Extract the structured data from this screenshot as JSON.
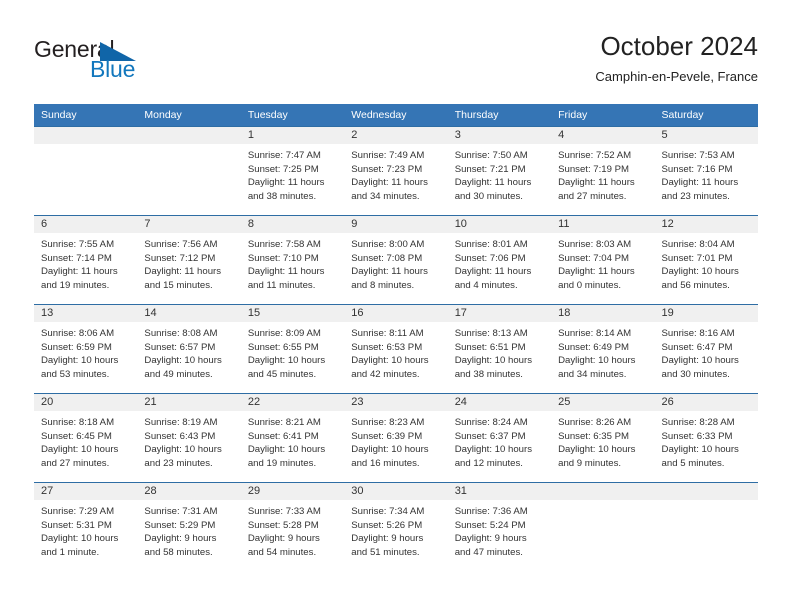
{
  "brand": {
    "name_part1": "General",
    "name_part2": "Blue",
    "logo_icon": "blue-triangle-flag-icon",
    "colors": {
      "text_dark": "#231f20",
      "blue": "#1277bd"
    }
  },
  "header": {
    "title": "October 2024",
    "subtitle": "Camphin-en-Pevele, France"
  },
  "theme": {
    "header_blue": "#3575b5",
    "row_divider_blue": "#2e6da4",
    "daynum_band": "#f0f0f0",
    "body_text": "#333333"
  },
  "weekday_headers": [
    "Sunday",
    "Monday",
    "Tuesday",
    "Wednesday",
    "Thursday",
    "Friday",
    "Saturday"
  ],
  "weeks": [
    [
      {
        "day": "",
        "blank": true,
        "sunrise": "",
        "sunset": "",
        "daylight_line1": "",
        "daylight_line2": ""
      },
      {
        "day": "",
        "blank": true,
        "sunrise": "",
        "sunset": "",
        "daylight_line1": "",
        "daylight_line2": ""
      },
      {
        "day": "1",
        "blank": false,
        "sunrise": "Sunrise: 7:47 AM",
        "sunset": "Sunset: 7:25 PM",
        "daylight_line1": "Daylight: 11 hours",
        "daylight_line2": "and 38 minutes."
      },
      {
        "day": "2",
        "blank": false,
        "sunrise": "Sunrise: 7:49 AM",
        "sunset": "Sunset: 7:23 PM",
        "daylight_line1": "Daylight: 11 hours",
        "daylight_line2": "and 34 minutes."
      },
      {
        "day": "3",
        "blank": false,
        "sunrise": "Sunrise: 7:50 AM",
        "sunset": "Sunset: 7:21 PM",
        "daylight_line1": "Daylight: 11 hours",
        "daylight_line2": "and 30 minutes."
      },
      {
        "day": "4",
        "blank": false,
        "sunrise": "Sunrise: 7:52 AM",
        "sunset": "Sunset: 7:19 PM",
        "daylight_line1": "Daylight: 11 hours",
        "daylight_line2": "and 27 minutes."
      },
      {
        "day": "5",
        "blank": false,
        "sunrise": "Sunrise: 7:53 AM",
        "sunset": "Sunset: 7:16 PM",
        "daylight_line1": "Daylight: 11 hours",
        "daylight_line2": "and 23 minutes."
      }
    ],
    [
      {
        "day": "6",
        "blank": false,
        "sunrise": "Sunrise: 7:55 AM",
        "sunset": "Sunset: 7:14 PM",
        "daylight_line1": "Daylight: 11 hours",
        "daylight_line2": "and 19 minutes."
      },
      {
        "day": "7",
        "blank": false,
        "sunrise": "Sunrise: 7:56 AM",
        "sunset": "Sunset: 7:12 PM",
        "daylight_line1": "Daylight: 11 hours",
        "daylight_line2": "and 15 minutes."
      },
      {
        "day": "8",
        "blank": false,
        "sunrise": "Sunrise: 7:58 AM",
        "sunset": "Sunset: 7:10 PM",
        "daylight_line1": "Daylight: 11 hours",
        "daylight_line2": "and 11 minutes."
      },
      {
        "day": "9",
        "blank": false,
        "sunrise": "Sunrise: 8:00 AM",
        "sunset": "Sunset: 7:08 PM",
        "daylight_line1": "Daylight: 11 hours",
        "daylight_line2": "and 8 minutes."
      },
      {
        "day": "10",
        "blank": false,
        "sunrise": "Sunrise: 8:01 AM",
        "sunset": "Sunset: 7:06 PM",
        "daylight_line1": "Daylight: 11 hours",
        "daylight_line2": "and 4 minutes."
      },
      {
        "day": "11",
        "blank": false,
        "sunrise": "Sunrise: 8:03 AM",
        "sunset": "Sunset: 7:04 PM",
        "daylight_line1": "Daylight: 11 hours",
        "daylight_line2": "and 0 minutes."
      },
      {
        "day": "12",
        "blank": false,
        "sunrise": "Sunrise: 8:04 AM",
        "sunset": "Sunset: 7:01 PM",
        "daylight_line1": "Daylight: 10 hours",
        "daylight_line2": "and 56 minutes."
      }
    ],
    [
      {
        "day": "13",
        "blank": false,
        "sunrise": "Sunrise: 8:06 AM",
        "sunset": "Sunset: 6:59 PM",
        "daylight_line1": "Daylight: 10 hours",
        "daylight_line2": "and 53 minutes."
      },
      {
        "day": "14",
        "blank": false,
        "sunrise": "Sunrise: 8:08 AM",
        "sunset": "Sunset: 6:57 PM",
        "daylight_line1": "Daylight: 10 hours",
        "daylight_line2": "and 49 minutes."
      },
      {
        "day": "15",
        "blank": false,
        "sunrise": "Sunrise: 8:09 AM",
        "sunset": "Sunset: 6:55 PM",
        "daylight_line1": "Daylight: 10 hours",
        "daylight_line2": "and 45 minutes."
      },
      {
        "day": "16",
        "blank": false,
        "sunrise": "Sunrise: 8:11 AM",
        "sunset": "Sunset: 6:53 PM",
        "daylight_line1": "Daylight: 10 hours",
        "daylight_line2": "and 42 minutes."
      },
      {
        "day": "17",
        "blank": false,
        "sunrise": "Sunrise: 8:13 AM",
        "sunset": "Sunset: 6:51 PM",
        "daylight_line1": "Daylight: 10 hours",
        "daylight_line2": "and 38 minutes."
      },
      {
        "day": "18",
        "blank": false,
        "sunrise": "Sunrise: 8:14 AM",
        "sunset": "Sunset: 6:49 PM",
        "daylight_line1": "Daylight: 10 hours",
        "daylight_line2": "and 34 minutes."
      },
      {
        "day": "19",
        "blank": false,
        "sunrise": "Sunrise: 8:16 AM",
        "sunset": "Sunset: 6:47 PM",
        "daylight_line1": "Daylight: 10 hours",
        "daylight_line2": "and 30 minutes."
      }
    ],
    [
      {
        "day": "20",
        "blank": false,
        "sunrise": "Sunrise: 8:18 AM",
        "sunset": "Sunset: 6:45 PM",
        "daylight_line1": "Daylight: 10 hours",
        "daylight_line2": "and 27 minutes."
      },
      {
        "day": "21",
        "blank": false,
        "sunrise": "Sunrise: 8:19 AM",
        "sunset": "Sunset: 6:43 PM",
        "daylight_line1": "Daylight: 10 hours",
        "daylight_line2": "and 23 minutes."
      },
      {
        "day": "22",
        "blank": false,
        "sunrise": "Sunrise: 8:21 AM",
        "sunset": "Sunset: 6:41 PM",
        "daylight_line1": "Daylight: 10 hours",
        "daylight_line2": "and 19 minutes."
      },
      {
        "day": "23",
        "blank": false,
        "sunrise": "Sunrise: 8:23 AM",
        "sunset": "Sunset: 6:39 PM",
        "daylight_line1": "Daylight: 10 hours",
        "daylight_line2": "and 16 minutes."
      },
      {
        "day": "24",
        "blank": false,
        "sunrise": "Sunrise: 8:24 AM",
        "sunset": "Sunset: 6:37 PM",
        "daylight_line1": "Daylight: 10 hours",
        "daylight_line2": "and 12 minutes."
      },
      {
        "day": "25",
        "blank": false,
        "sunrise": "Sunrise: 8:26 AM",
        "sunset": "Sunset: 6:35 PM",
        "daylight_line1": "Daylight: 10 hours",
        "daylight_line2": "and 9 minutes."
      },
      {
        "day": "26",
        "blank": false,
        "sunrise": "Sunrise: 8:28 AM",
        "sunset": "Sunset: 6:33 PM",
        "daylight_line1": "Daylight: 10 hours",
        "daylight_line2": "and 5 minutes."
      }
    ],
    [
      {
        "day": "27",
        "blank": false,
        "sunrise": "Sunrise: 7:29 AM",
        "sunset": "Sunset: 5:31 PM",
        "daylight_line1": "Daylight: 10 hours",
        "daylight_line2": "and 1 minute."
      },
      {
        "day": "28",
        "blank": false,
        "sunrise": "Sunrise: 7:31 AM",
        "sunset": "Sunset: 5:29 PM",
        "daylight_line1": "Daylight: 9 hours",
        "daylight_line2": "and 58 minutes."
      },
      {
        "day": "29",
        "blank": false,
        "sunrise": "Sunrise: 7:33 AM",
        "sunset": "Sunset: 5:28 PM",
        "daylight_line1": "Daylight: 9 hours",
        "daylight_line2": "and 54 minutes."
      },
      {
        "day": "30",
        "blank": false,
        "sunrise": "Sunrise: 7:34 AM",
        "sunset": "Sunset: 5:26 PM",
        "daylight_line1": "Daylight: 9 hours",
        "daylight_line2": "and 51 minutes."
      },
      {
        "day": "31",
        "blank": false,
        "sunrise": "Sunrise: 7:36 AM",
        "sunset": "Sunset: 5:24 PM",
        "daylight_line1": "Daylight: 9 hours",
        "daylight_line2": "and 47 minutes."
      },
      {
        "day": "",
        "blank": true,
        "sunrise": "",
        "sunset": "",
        "daylight_line1": "",
        "daylight_line2": ""
      },
      {
        "day": "",
        "blank": true,
        "sunrise": "",
        "sunset": "",
        "daylight_line1": "",
        "daylight_line2": ""
      }
    ]
  ]
}
